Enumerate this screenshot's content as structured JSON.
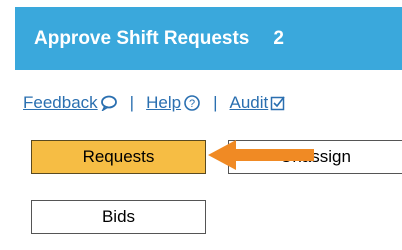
{
  "header": {
    "title": "Approve Shift Requests",
    "count": "2",
    "bg_color": "#3aa8dc"
  },
  "links": {
    "feedback": "Feedback",
    "help": "Help",
    "audit": "Audit",
    "separator": "|",
    "feedback_icon": "speech-bubble-icon",
    "help_icon": "question-circle-icon",
    "audit_icon": "checkbox-icon"
  },
  "buttons": {
    "requests": "Requests",
    "unassign": "Unassign",
    "bids": "Bids",
    "active_color": "#f6bd44"
  },
  "annotation": {
    "arrow_color": "#f08a24",
    "arrow_icon": "left-arrow-icon"
  }
}
